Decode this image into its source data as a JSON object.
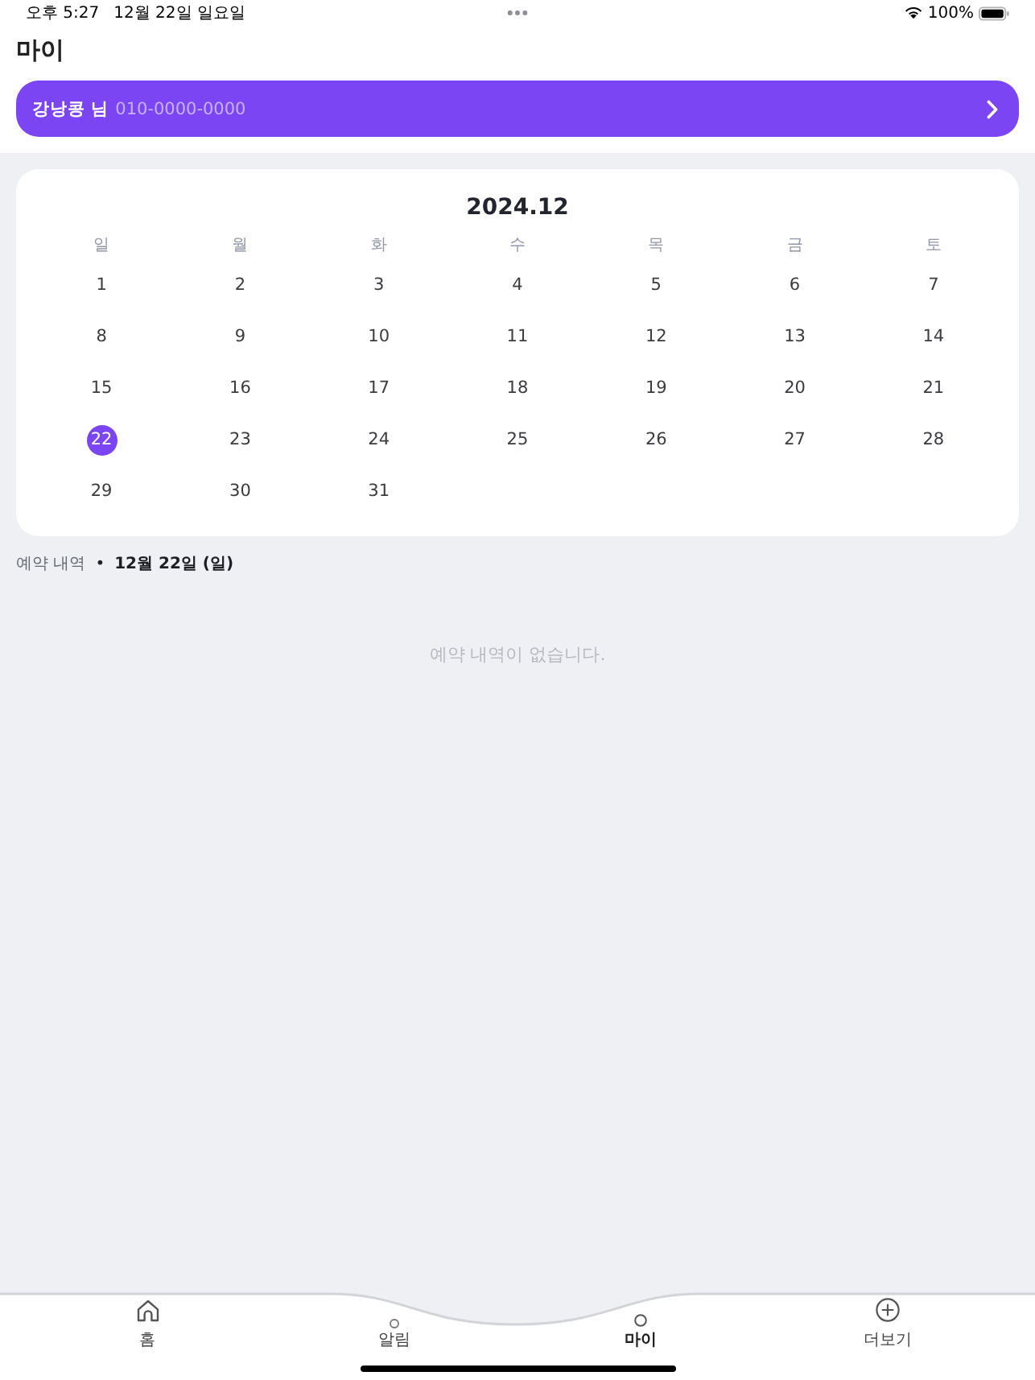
{
  "status_bar": {
    "time": "오후 5:27",
    "date": "12월 22일 일요일",
    "battery": "100%"
  },
  "header": {
    "title": "마이"
  },
  "profile": {
    "name": "강낭콩 님",
    "phone": "010-0000-0000"
  },
  "calendar": {
    "title": "2024.12",
    "weekdays": [
      "일",
      "월",
      "화",
      "수",
      "목",
      "금",
      "토"
    ],
    "weeks": [
      [
        {
          "label": "1",
          "selected": false
        },
        {
          "label": "2",
          "selected": false
        },
        {
          "label": "3",
          "selected": false
        },
        {
          "label": "4",
          "selected": false
        },
        {
          "label": "5",
          "selected": false
        },
        {
          "label": "6",
          "selected": false
        },
        {
          "label": "7",
          "selected": false
        }
      ],
      [
        {
          "label": "8",
          "selected": false
        },
        {
          "label": "9",
          "selected": false
        },
        {
          "label": "10",
          "selected": false
        },
        {
          "label": "11",
          "selected": false
        },
        {
          "label": "12",
          "selected": false
        },
        {
          "label": "13",
          "selected": false
        },
        {
          "label": "14",
          "selected": false
        }
      ],
      [
        {
          "label": "15",
          "selected": false
        },
        {
          "label": "16",
          "selected": false
        },
        {
          "label": "17",
          "selected": false
        },
        {
          "label": "18",
          "selected": false
        },
        {
          "label": "19",
          "selected": false
        },
        {
          "label": "20",
          "selected": false
        },
        {
          "label": "21",
          "selected": false
        }
      ],
      [
        {
          "label": "22",
          "selected": true
        },
        {
          "label": "23",
          "selected": false
        },
        {
          "label": "24",
          "selected": false
        },
        {
          "label": "25",
          "selected": false
        },
        {
          "label": "26",
          "selected": false
        },
        {
          "label": "27",
          "selected": false
        },
        {
          "label": "28",
          "selected": false
        }
      ],
      [
        {
          "label": "29",
          "selected": false
        },
        {
          "label": "30",
          "selected": false
        },
        {
          "label": "31",
          "selected": false
        }
      ]
    ]
  },
  "reservations": {
    "label": "예약 내역",
    "separator": "•",
    "date": "12월 22일 (일)",
    "empty_message": "예약 내역이 없습니다."
  },
  "tab_bar": {
    "tabs": [
      {
        "label": "홈",
        "selected": false
      },
      {
        "label": "알림",
        "selected": false
      },
      {
        "label": "마이",
        "selected": true
      },
      {
        "label": "더보기",
        "selected": false
      }
    ]
  }
}
